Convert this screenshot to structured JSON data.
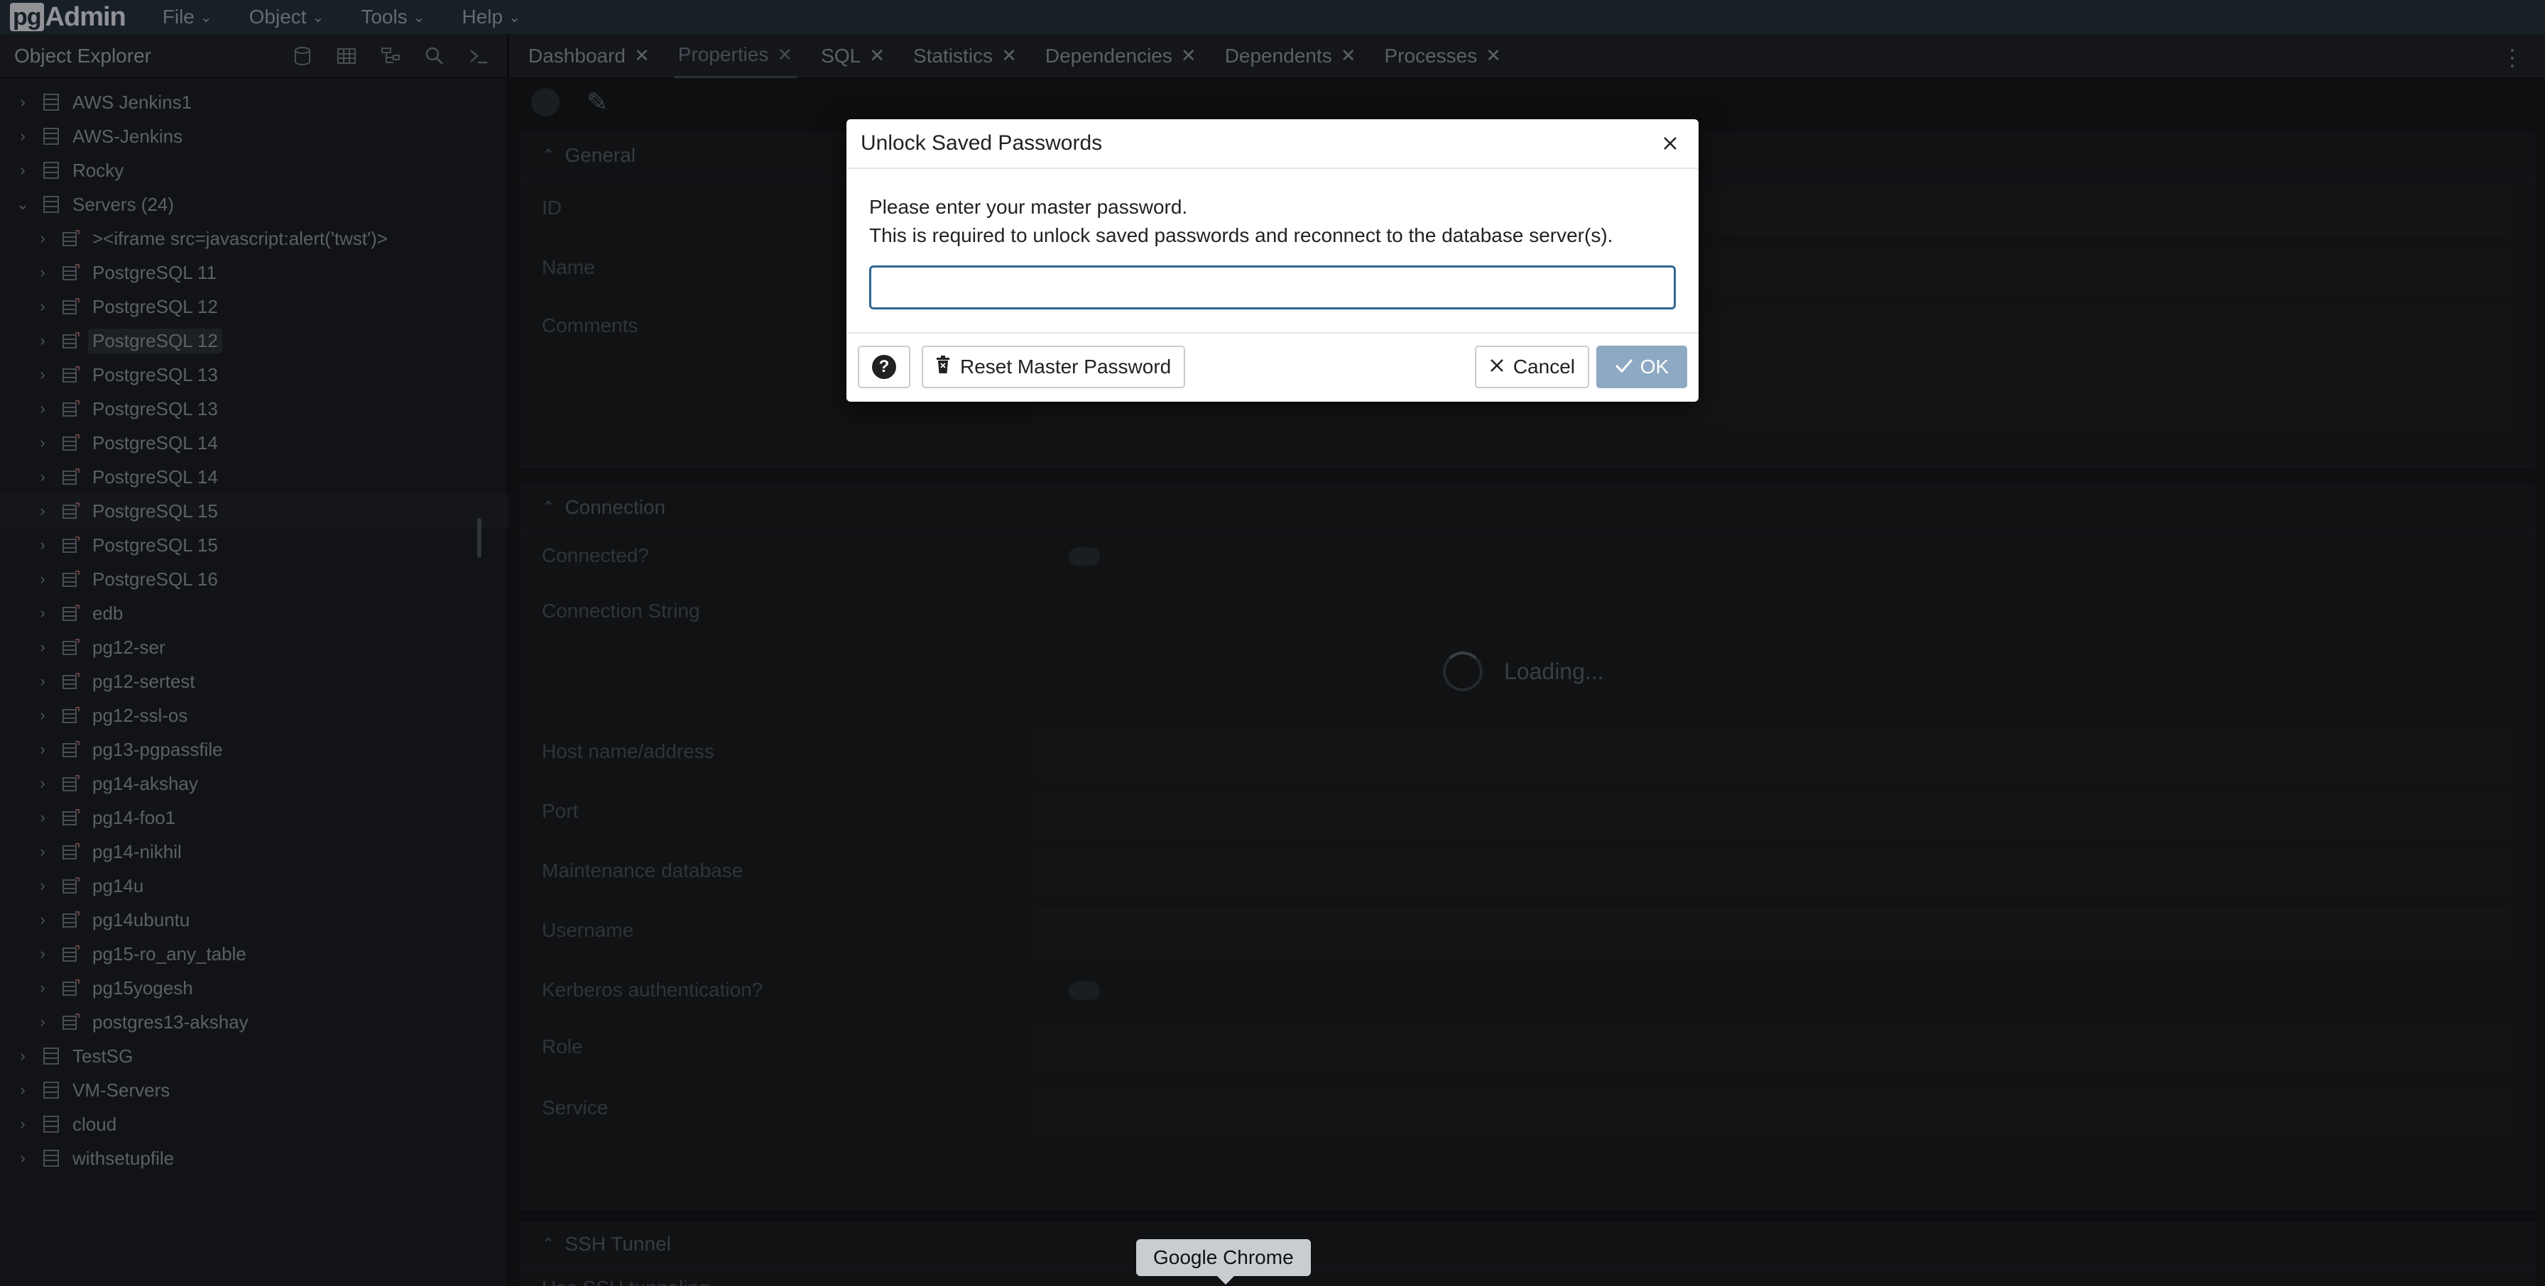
{
  "app": {
    "logo_prefix": "pg",
    "logo_text": "Admin",
    "menus": [
      "File",
      "Object",
      "Tools",
      "Help"
    ]
  },
  "explorer": {
    "title": "Object Explorer",
    "tree": [
      {
        "label": "AWS Jenkins1",
        "level": 0,
        "expanded": false
      },
      {
        "label": "AWS-Jenkins",
        "level": 0,
        "expanded": false
      },
      {
        "label": "Rocky",
        "level": 0,
        "expanded": false
      },
      {
        "label": "Servers (24)",
        "level": 0,
        "expanded": true
      },
      {
        "label": "><iframe src=javascript:alert('twst')>",
        "level": 1
      },
      {
        "label": "PostgreSQL 11",
        "level": 1
      },
      {
        "label": "PostgreSQL 12",
        "level": 1
      },
      {
        "label": "PostgreSQL 12",
        "level": 1,
        "selected": true
      },
      {
        "label": "PostgreSQL 13",
        "level": 1
      },
      {
        "label": "PostgreSQL 13",
        "level": 1
      },
      {
        "label": "PostgreSQL 14",
        "level": 1
      },
      {
        "label": "PostgreSQL 14",
        "level": 1
      },
      {
        "label": "PostgreSQL 15",
        "level": 1,
        "hover": true
      },
      {
        "label": "PostgreSQL 15",
        "level": 1
      },
      {
        "label": "PostgreSQL 16",
        "level": 1
      },
      {
        "label": "edb",
        "level": 1
      },
      {
        "label": "pg12-ser",
        "level": 1
      },
      {
        "label": "pg12-sertest",
        "level": 1
      },
      {
        "label": "pg12-ssl-os",
        "level": 1
      },
      {
        "label": "pg13-pgpassfile",
        "level": 1
      },
      {
        "label": "pg14-akshay",
        "level": 1
      },
      {
        "label": "pg14-foo1",
        "level": 1
      },
      {
        "label": "pg14-nikhil",
        "level": 1
      },
      {
        "label": "pg14u",
        "level": 1
      },
      {
        "label": "pg14ubuntu",
        "level": 1
      },
      {
        "label": "pg15-ro_any_table",
        "level": 1
      },
      {
        "label": "pg15yogesh",
        "level": 1
      },
      {
        "label": "postgres13-akshay",
        "level": 1
      },
      {
        "label": "TestSG",
        "level": 0,
        "expanded": false
      },
      {
        "label": "VM-Servers",
        "level": 0,
        "expanded": false
      },
      {
        "label": "cloud",
        "level": 0,
        "expanded": false
      },
      {
        "label": "withsetupfile",
        "level": 0,
        "expanded": false
      }
    ]
  },
  "tabs": [
    {
      "label": "Dashboard",
      "active": false
    },
    {
      "label": "Properties",
      "active": true
    },
    {
      "label": "SQL",
      "active": false
    },
    {
      "label": "Statistics",
      "active": false
    },
    {
      "label": "Dependencies",
      "active": false
    },
    {
      "label": "Dependents",
      "active": false
    },
    {
      "label": "Processes",
      "active": false
    }
  ],
  "properties": {
    "general_title": "General",
    "general_fields": [
      "ID",
      "Name",
      "Comments"
    ],
    "connection_title": "Connection",
    "connection_fields": [
      "Connected?",
      "Connection String",
      "Host name/address",
      "Port",
      "Maintenance database",
      "Username",
      "Kerberos authentication?",
      "Role",
      "Service"
    ],
    "ssh_title": "SSH Tunnel",
    "ssh_fields": [
      "Use SSH tunneling"
    ],
    "loading_text": "Loading..."
  },
  "modal": {
    "title": "Unlock Saved Passwords",
    "line1": "Please enter your master password.",
    "line2": "This is required to unlock saved passwords and reconnect to the database server(s).",
    "password_value": "",
    "reset_label": "Reset Master Password",
    "cancel_label": "Cancel",
    "ok_label": "OK"
  },
  "tooltip": {
    "text": "Google Chrome"
  },
  "colors": {
    "menubar_bg": "#24303d",
    "input_border": "#326690",
    "ok_button_bg": "#8ea9c3"
  }
}
